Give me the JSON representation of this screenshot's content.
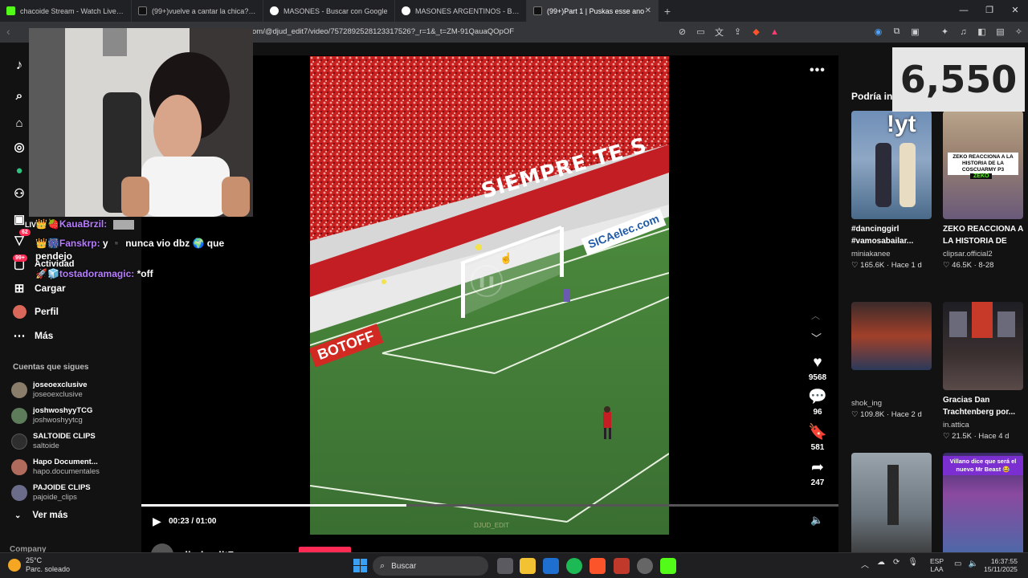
{
  "browser": {
    "tabs": [
      {
        "title": "chacoide Stream - Watch Live on",
        "color": "#53fc18"
      },
      {
        "title": "(99+)vuelve a cantar la chica? Jajajaj",
        "color": "#ffffff"
      },
      {
        "title": "MASONES - Buscar con Google",
        "color": "#4285f4"
      },
      {
        "title": "MASONES ARGENTINOS - Buscar con",
        "color": "#4285f4"
      },
      {
        "title": "(99+)Part 1 | Puskas esse ano",
        "color": "#ffffff"
      }
    ],
    "new_tab": "+",
    "url": "om/@djud_edit7/video/7572892528123317526?_r=1&_t=ZM-91QauaQOpOF"
  },
  "sidebar": {
    "nav": [
      {
        "label": "LIVE",
        "icon": "live-icon"
      },
      {
        "label": "Actividad",
        "icon": "inbox-icon",
        "badge": "99+"
      },
      {
        "label": "Cargar",
        "icon": "upload-icon"
      },
      {
        "label": "Perfil",
        "icon": "profile-icon"
      },
      {
        "label": "Más",
        "icon": "more-icon"
      }
    ],
    "messages_badge": "62",
    "following_title": "Cuentas que sigues",
    "accounts": [
      {
        "display": "joseoexclusive",
        "user": "joseoexclusive",
        "color": "#8a7d6a"
      },
      {
        "display": "joshwoshyyTCG",
        "user": "joshwoshyytcg",
        "color": "#5d7c5a"
      },
      {
        "display": "SALTOIDE CLIPS",
        "user": "saltoide",
        "color": "#2e2e2e"
      },
      {
        "display": "Hapo Document...",
        "user": "hapo.documentales",
        "color": "#b06b5c"
      },
      {
        "display": "PAJOIDE CLIPS",
        "user": "pajoide_clips",
        "color": "#6b6b8a"
      }
    ],
    "see_more": "Ver más",
    "company": "Company"
  },
  "video": {
    "counts": {
      "likes": "9568",
      "comments": "96",
      "saves": "581",
      "shares": "247"
    },
    "time": "00:23 / 01:00",
    "progress": 0.38,
    "author": "djud_edit7",
    "watermark": "DJUD_EDIT",
    "banner_text": "SIEMPRE TE S",
    "sponsor": "SICAelec.com",
    "ad_text": "BOTOFF"
  },
  "right": {
    "title": "Podría in",
    "cards": [
      {
        "title": "#dancinggirl #vamosabailar...",
        "author": "miniakanee",
        "stats": "♡ 165.6K · Hace 1 d",
        "overlay": "!yt"
      },
      {
        "title": "ZEKO REACCIONA A LA HISTORIA DE LA...",
        "author": "clipsar.official2",
        "stats": "♡ 46.5K · 8-28",
        "overlay": "ZEKO REACCIONA A LA HISTORIA DE LA COSCUARMY P3",
        "tag": "ZEKO"
      },
      {
        "title": "",
        "author": "shok_ing",
        "stats": "♡ 109.8K · Hace 2 d"
      },
      {
        "title": "Gracias Dan Trachtenberg por...",
        "author": "in.attica",
        "stats": "♡ 21.5K · Hace 4 d"
      },
      {
        "title": "",
        "author": "",
        "stats": ""
      },
      {
        "title": "",
        "author": "",
        "stats": "",
        "overlay": "Villano dice que será el nuevo Mr Beast 😂"
      }
    ]
  },
  "stream": {
    "counter": "6,550",
    "chat": [
      {
        "user": "👑🍓KauaBrzil:",
        "msg": ""
      },
      {
        "user": "👑🎆Fanskrp:",
        "msg": "y ▪️ nunca vio dbz 🌍 que pendejo"
      },
      {
        "user": "🚀🧊tostadoramagic:",
        "msg": "*off"
      }
    ]
  },
  "taskbar": {
    "temp": "25°C",
    "weather": "Parc. soleado",
    "search": "Buscar",
    "lang1": "ESP",
    "lang2": "LAA",
    "time": "16:37:55",
    "date": "15/11/2025"
  }
}
